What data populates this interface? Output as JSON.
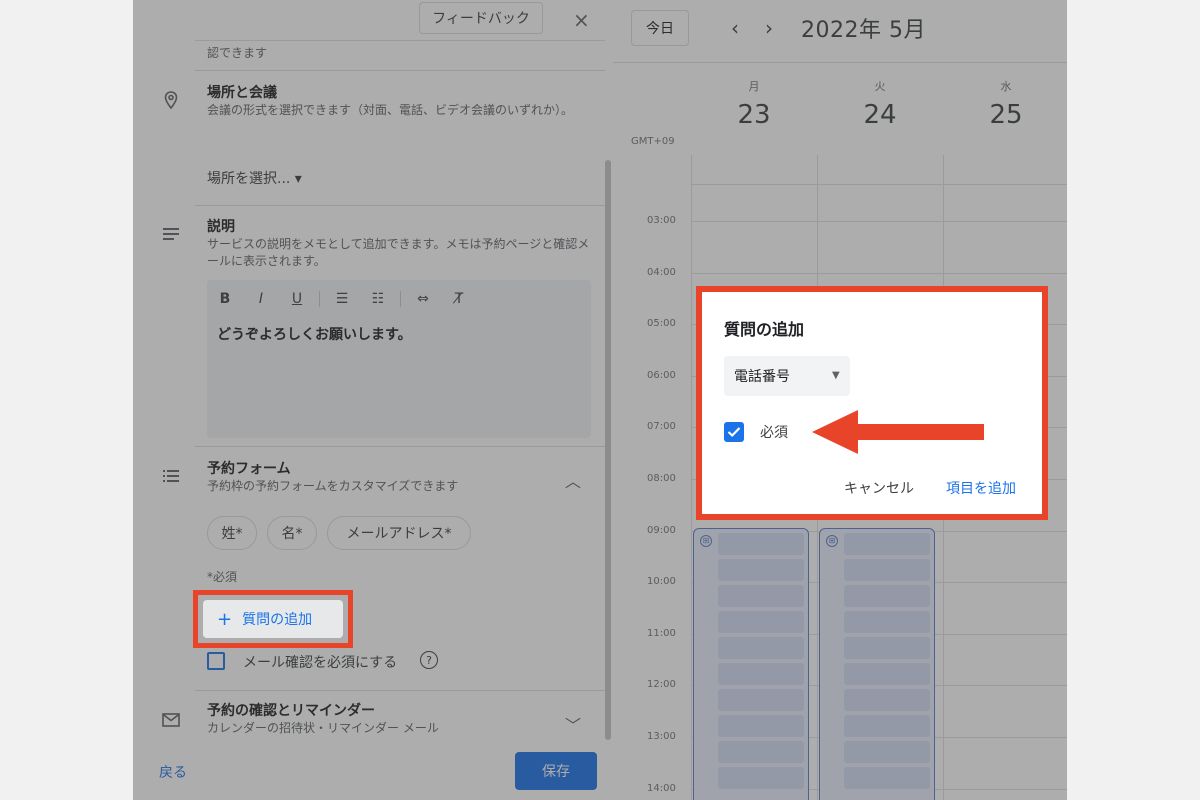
{
  "panel": {
    "feedback_label": "フィードバック",
    "close_icon": "×",
    "truncated_text": "認できます",
    "location": {
      "title": "場所と会議",
      "desc": "会議の形式を選択できます（対面、電話、ビデオ会議のいずれか）。",
      "select_label": "場所を選択... ▾"
    },
    "description": {
      "title": "説明",
      "desc": "サービスの説明をメモとして追加できます。メモは予約ページと確認メールに表示されます。",
      "toolbar": [
        "B",
        "I",
        "U",
        "☰",
        "☷",
        "⇔",
        "T̸"
      ],
      "editor_text": "どうぞよろしくお願いします。"
    },
    "booking_form": {
      "title": "予約フォーム",
      "desc": "予約枠の予約フォームをカスタマイズできます",
      "chips": [
        "姓*",
        "名*",
        "メールアドレス*"
      ],
      "required_note": "*必須",
      "add_question_label": "質問の追加",
      "email_confirm_label": "メール確認を必須にする",
      "help_icon": "?"
    },
    "reminder": {
      "title": "予約の確認とリマインダー",
      "desc": "カレンダーの招待状・リマインダー メール"
    },
    "back_label": "戻る",
    "save_label": "保存"
  },
  "calendar": {
    "today_label": "今日",
    "prev_icon": "‹",
    "next_icon": "›",
    "month_label": "2022年 5月",
    "timezone": "GMT+09",
    "days": [
      {
        "name": "月",
        "num": "23"
      },
      {
        "name": "火",
        "num": "24"
      },
      {
        "name": "水",
        "num": "25"
      }
    ],
    "times": [
      "03:00",
      "04:00",
      "05:00",
      "06:00",
      "07:00",
      "08:00",
      "09:00",
      "10:00",
      "11:00",
      "12:00",
      "13:00",
      "14:00"
    ]
  },
  "dialog": {
    "title": "質問の追加",
    "select_value": "電話番号",
    "required_label": "必須",
    "cancel_label": "キャンセル",
    "add_label": "項目を追加"
  },
  "colors": {
    "accent": "#1a73e8",
    "highlight": "#e8442a"
  }
}
